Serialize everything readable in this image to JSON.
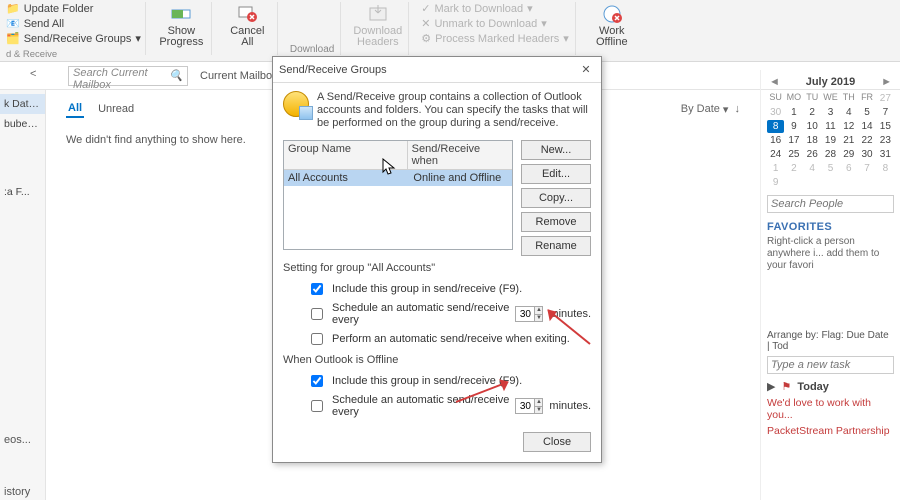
{
  "ribbon": {
    "left": {
      "update_folder": "Update Folder",
      "send_all": "Send All",
      "sr_groups": "Send/Receive Groups",
      "receive_group_lbl": "d & Receive"
    },
    "progress": {
      "line1": "Show",
      "line2": "Progress"
    },
    "cancel": {
      "line1": "Cancel",
      "line2": "All"
    },
    "download_bottom": "Download",
    "dl_headers": {
      "line1": "Download",
      "line2": "Headers"
    },
    "markdl": "Mark to Download",
    "unmark": "Unmark to Download",
    "process": "Process Marked Headers",
    "work_offline": {
      "line1": "Work",
      "line2": "Offline"
    }
  },
  "search": {
    "placeholder_mail": "Search Current Mailbox",
    "tab_current": "Current Mailbox"
  },
  "left_nodes": {
    "n1": "k Data F...",
    "n2": "bubevide",
    "n3": ":a F...",
    "n4": "eos...",
    "n5": "istory"
  },
  "main_area": {
    "all": "All",
    "unread": "Unread",
    "bydate": "By Date",
    "empty": "We didn't find anything to show here."
  },
  "calendar": {
    "title": "July 2019",
    "dow": [
      "SU",
      "MO",
      "TU",
      "WE",
      "TH",
      "FR"
    ],
    "rows": [
      [
        "30",
        "1",
        "2",
        "3",
        "4",
        "5"
      ],
      [
        "7",
        "8",
        "9",
        "10",
        "11",
        "12"
      ],
      [
        "14",
        "15",
        "16",
        "17",
        "18",
        "19"
      ],
      [
        "21",
        "22",
        "23",
        "24",
        "25",
        "26"
      ],
      [
        "28",
        "29",
        "30",
        "31",
        "1",
        "2"
      ],
      [
        "4",
        "5",
        "6",
        "7",
        "8",
        "9"
      ]
    ],
    "today_index": 8,
    "prev_ext": 1,
    "next_ext_start": 28
  },
  "right": {
    "search_people": "Search People",
    "favorites": "FAVORITES",
    "favorites_hint": "Right-click a person anywhere i... add them to your favori",
    "arrange": "Arrange by: Flag: Due Date | Tod",
    "new_task": "Type a new task",
    "today": "Today",
    "link1": "We'd love to work with you...",
    "link2": "PacketStream Partnership"
  },
  "dialog": {
    "title": "Send/Receive Groups",
    "description": "A Send/Receive group contains a collection of Outlook accounts and folders. You can specify the tasks that will be performed on the group during a send/receive.",
    "col_group": "Group Name",
    "col_when": "Send/Receive when",
    "row_group": "All Accounts",
    "row_when": "Online and Offline",
    "btn_new": "New...",
    "btn_edit": "Edit...",
    "btn_copy": "Copy...",
    "btn_remove": "Remove",
    "btn_rename": "Rename",
    "setting_for": "Setting for group \"All Accounts\"",
    "include": "Include this group in send/receive (F9).",
    "schedule": "Schedule an automatic send/receive every",
    "minutes": "minutes.",
    "on_exit": "Perform an automatic send/receive when exiting.",
    "offline_heading": "When Outlook is Offline",
    "spin1": "30",
    "spin2": "30",
    "close": "Close"
  },
  "ext": {
    "prev_num": "27"
  }
}
